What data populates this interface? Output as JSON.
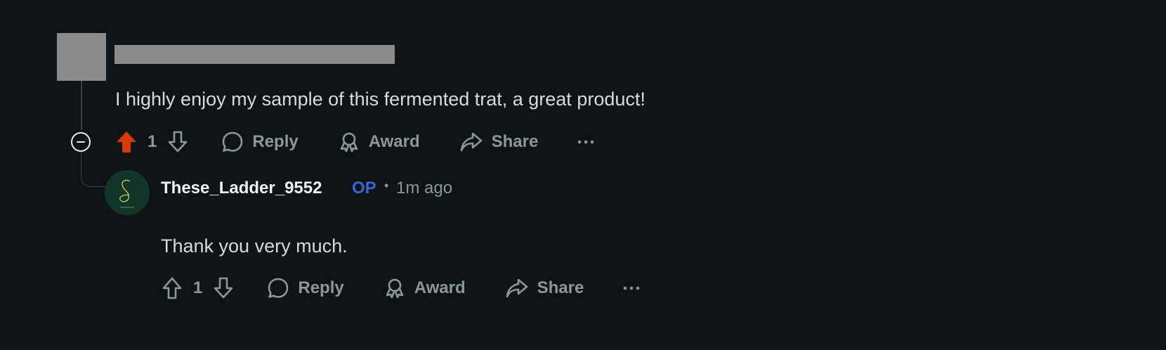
{
  "parent_comment": {
    "text": "I highly enjoy my sample of this fermented trat, a great product!",
    "vote_count": "1",
    "upvoted": true,
    "actions": {
      "reply": "Reply",
      "award": "Award",
      "share": "Share"
    }
  },
  "reply_comment": {
    "username": "These_Ladder_9552",
    "op_badge": "OP",
    "separator": "•",
    "timestamp": "1m ago",
    "text": "Thank you very much.",
    "vote_count": "1",
    "upvoted": false,
    "actions": {
      "reply": "Reply",
      "award": "Award",
      "share": "Share"
    }
  },
  "colors": {
    "background": "#0e1416",
    "upvote_active": "#d93a00",
    "op_badge": "#3d64d6",
    "muted_text": "#8c979c"
  },
  "icons": [
    "collapse-icon",
    "upvote-icon",
    "downvote-icon",
    "comment-icon",
    "award-icon",
    "share-icon",
    "more-icon"
  ]
}
